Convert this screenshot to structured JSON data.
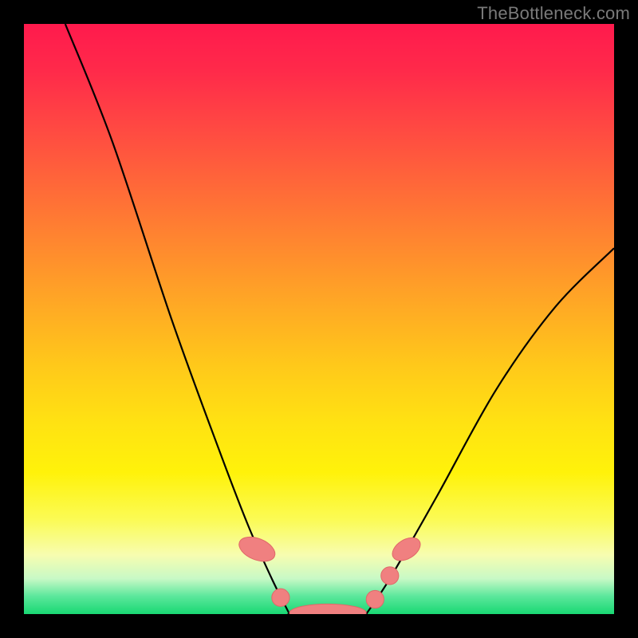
{
  "attribution": "TheBottleneck.com",
  "colors": {
    "curve_stroke": "#000000",
    "marker_fill": "#f08080",
    "marker_stroke": "#e06868",
    "gradient_top": "#ff1a4d",
    "gradient_bottom": "#19d873"
  },
  "chart_data": {
    "type": "line",
    "title": "",
    "xlabel": "",
    "ylabel": "",
    "xlim": [
      0,
      100
    ],
    "ylim": [
      0,
      100
    ],
    "series": [
      {
        "name": "left-branch",
        "x": [
          7,
          15,
          25,
          33,
          38,
          42,
          45
        ],
        "y": [
          100,
          80,
          50,
          28,
          15,
          6,
          0
        ]
      },
      {
        "name": "valley-floor",
        "x": [
          45,
          50,
          55,
          58
        ],
        "y": [
          0,
          0,
          0,
          0
        ]
      },
      {
        "name": "right-branch",
        "x": [
          58,
          62,
          70,
          80,
          90,
          100
        ],
        "y": [
          0,
          6,
          20,
          38,
          52,
          62
        ]
      }
    ],
    "markers": [
      {
        "kind": "pill",
        "cx": 39.5,
        "cy": 11,
        "rx": 1.8,
        "ry": 3.2,
        "angle": -68
      },
      {
        "kind": "dot",
        "cx": 43.5,
        "cy": 2.8,
        "r": 1.5
      },
      {
        "kind": "bar",
        "cx": 51.5,
        "cy": 0.2,
        "rx": 6.5,
        "ry": 1.5
      },
      {
        "kind": "dot",
        "cx": 59.5,
        "cy": 2.5,
        "r": 1.5
      },
      {
        "kind": "dot",
        "cx": 62.0,
        "cy": 6.5,
        "r": 1.5
      },
      {
        "kind": "pill",
        "cx": 64.8,
        "cy": 11,
        "rx": 1.6,
        "ry": 2.6,
        "angle": 58
      }
    ]
  }
}
